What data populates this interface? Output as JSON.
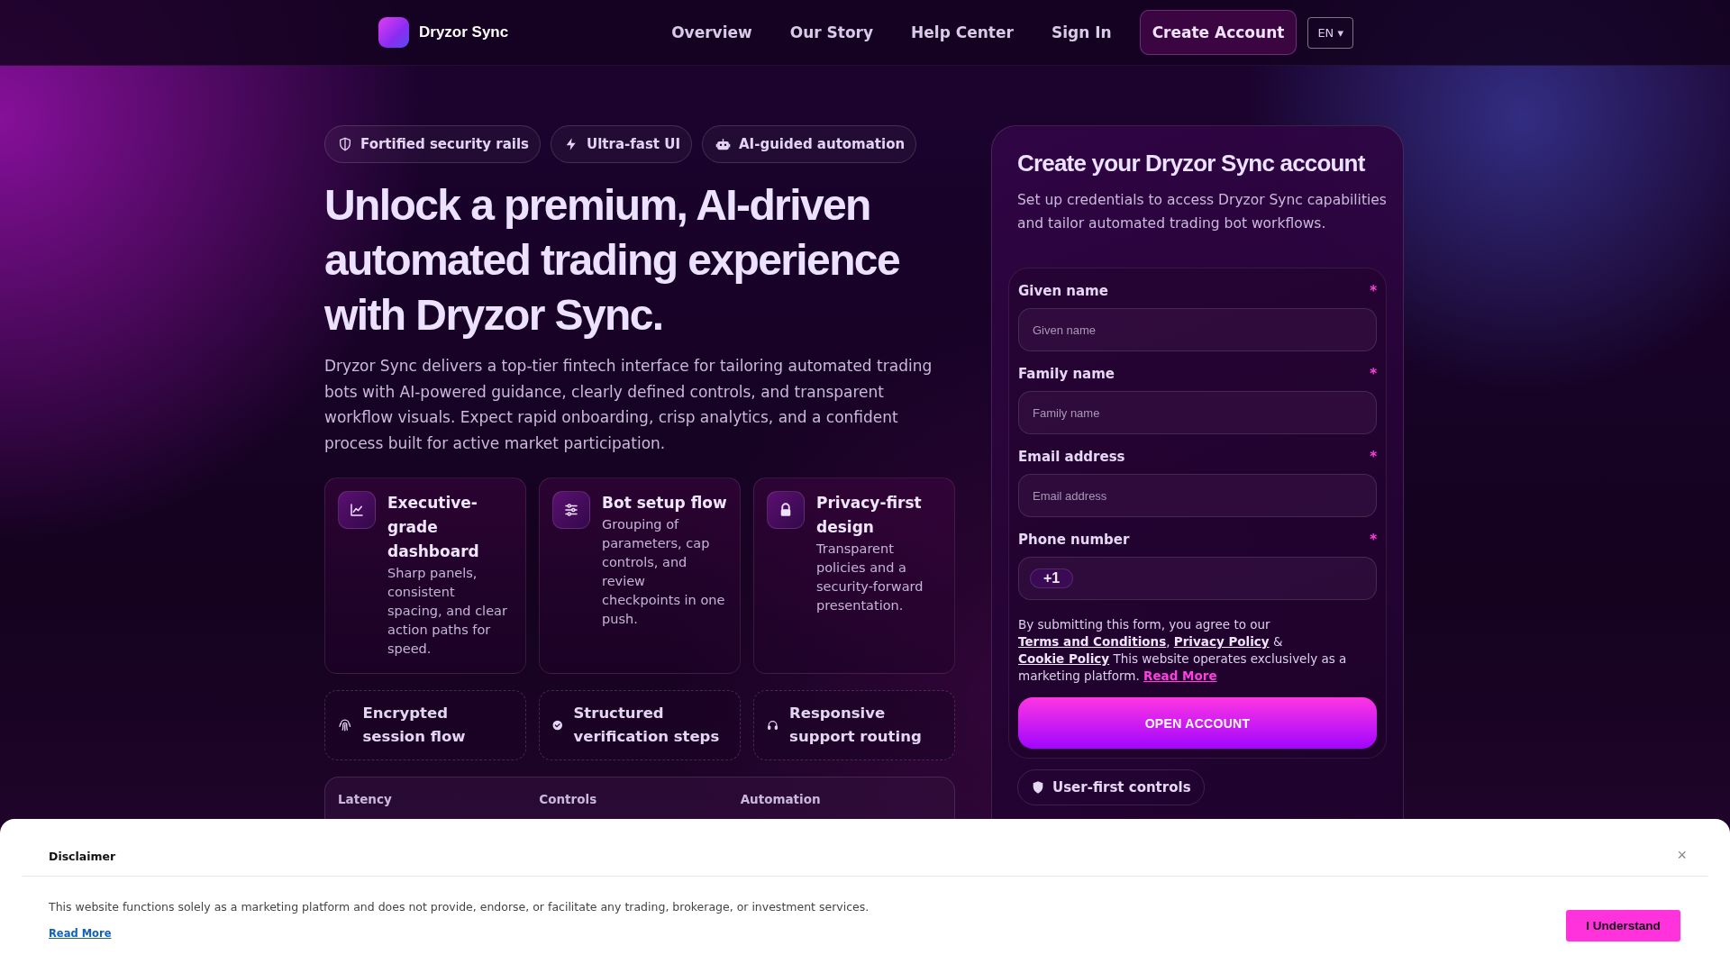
{
  "header": {
    "brand": "Dryzor Sync",
    "nav": [
      {
        "label": "Overview"
      },
      {
        "label": "Our Story"
      },
      {
        "label": "Help Center"
      },
      {
        "label": "Sign In"
      }
    ],
    "cta": "Create Account",
    "language": "EN ▾"
  },
  "hero": {
    "badges": [
      {
        "label": "Fortified security rails"
      },
      {
        "label": "Ultra-fast UI"
      },
      {
        "label": "AI-guided automation"
      }
    ],
    "title": "Unlock a premium, AI-driven automated trading experience with Dryzor Sync.",
    "description": "Dryzor Sync delivers a top-tier fintech interface for tailoring automated trading bots with AI-powered guidance, clearly defined controls, and transparent workflow visuals. Expect rapid onboarding, crisp analytics, and a confident process built for active market participation.",
    "features": [
      {
        "title": "Executive-grade dashboard",
        "text": "Sharp panels, consistent spacing, and clear action paths for speed."
      },
      {
        "title": "Bot setup flow",
        "text": "Grouping of parameters, cap controls, and review checkpoints in one push."
      },
      {
        "title": "Privacy-first design",
        "text": "Transparent policies and a security-forward presentation."
      }
    ],
    "highlights": [
      {
        "label": "Encrypted session flow"
      },
      {
        "label": "Structured verification steps"
      },
      {
        "label": "Responsive support routing"
      }
    ],
    "stats": [
      {
        "label": "Latency"
      },
      {
        "label": "Controls"
      },
      {
        "label": "Automation"
      }
    ]
  },
  "signup": {
    "title": "Create your Dryzor Sync account",
    "subtitle": "Set up credentials to access Dryzor Sync capabilities and tailor automated trading bot workflows.",
    "fields": [
      {
        "kind": "text",
        "label": "Given name",
        "required_mark": "*",
        "placeholder": "Given name"
      },
      {
        "kind": "text",
        "label": "Family name",
        "required_mark": "*",
        "placeholder": "Family name"
      },
      {
        "kind": "text",
        "label": "Email address",
        "required_mark": "*",
        "placeholder": "Email address"
      },
      {
        "kind": "phone",
        "label": "Phone number",
        "required_mark": "*",
        "prefix": "+1"
      }
    ],
    "consent": [
      {
        "kind": "text",
        "text": "By submitting this form, you agree to our "
      },
      {
        "kind": "link",
        "text": "Terms and Conditions"
      },
      {
        "kind": "text",
        "text": ", "
      },
      {
        "kind": "link",
        "text": "Privacy Policy"
      },
      {
        "kind": "text",
        "text": " & "
      },
      {
        "kind": "link",
        "text": "Cookie Policy"
      },
      {
        "kind": "text",
        "text": " This website operates exclusively as a marketing platform. "
      },
      {
        "kind": "accent",
        "text": "Read More"
      }
    ],
    "submit": "OPEN ACCOUNT",
    "chips": [
      {
        "label": "User-first controls"
      }
    ]
  },
  "disclaimer": {
    "title": "Disclaimer",
    "close": "×",
    "text": "This website functions solely as a marketing platform and does not provide, endorse, or facilitate any trading, brokerage, or investment services.",
    "link": "Read More",
    "button": "I Understand"
  }
}
